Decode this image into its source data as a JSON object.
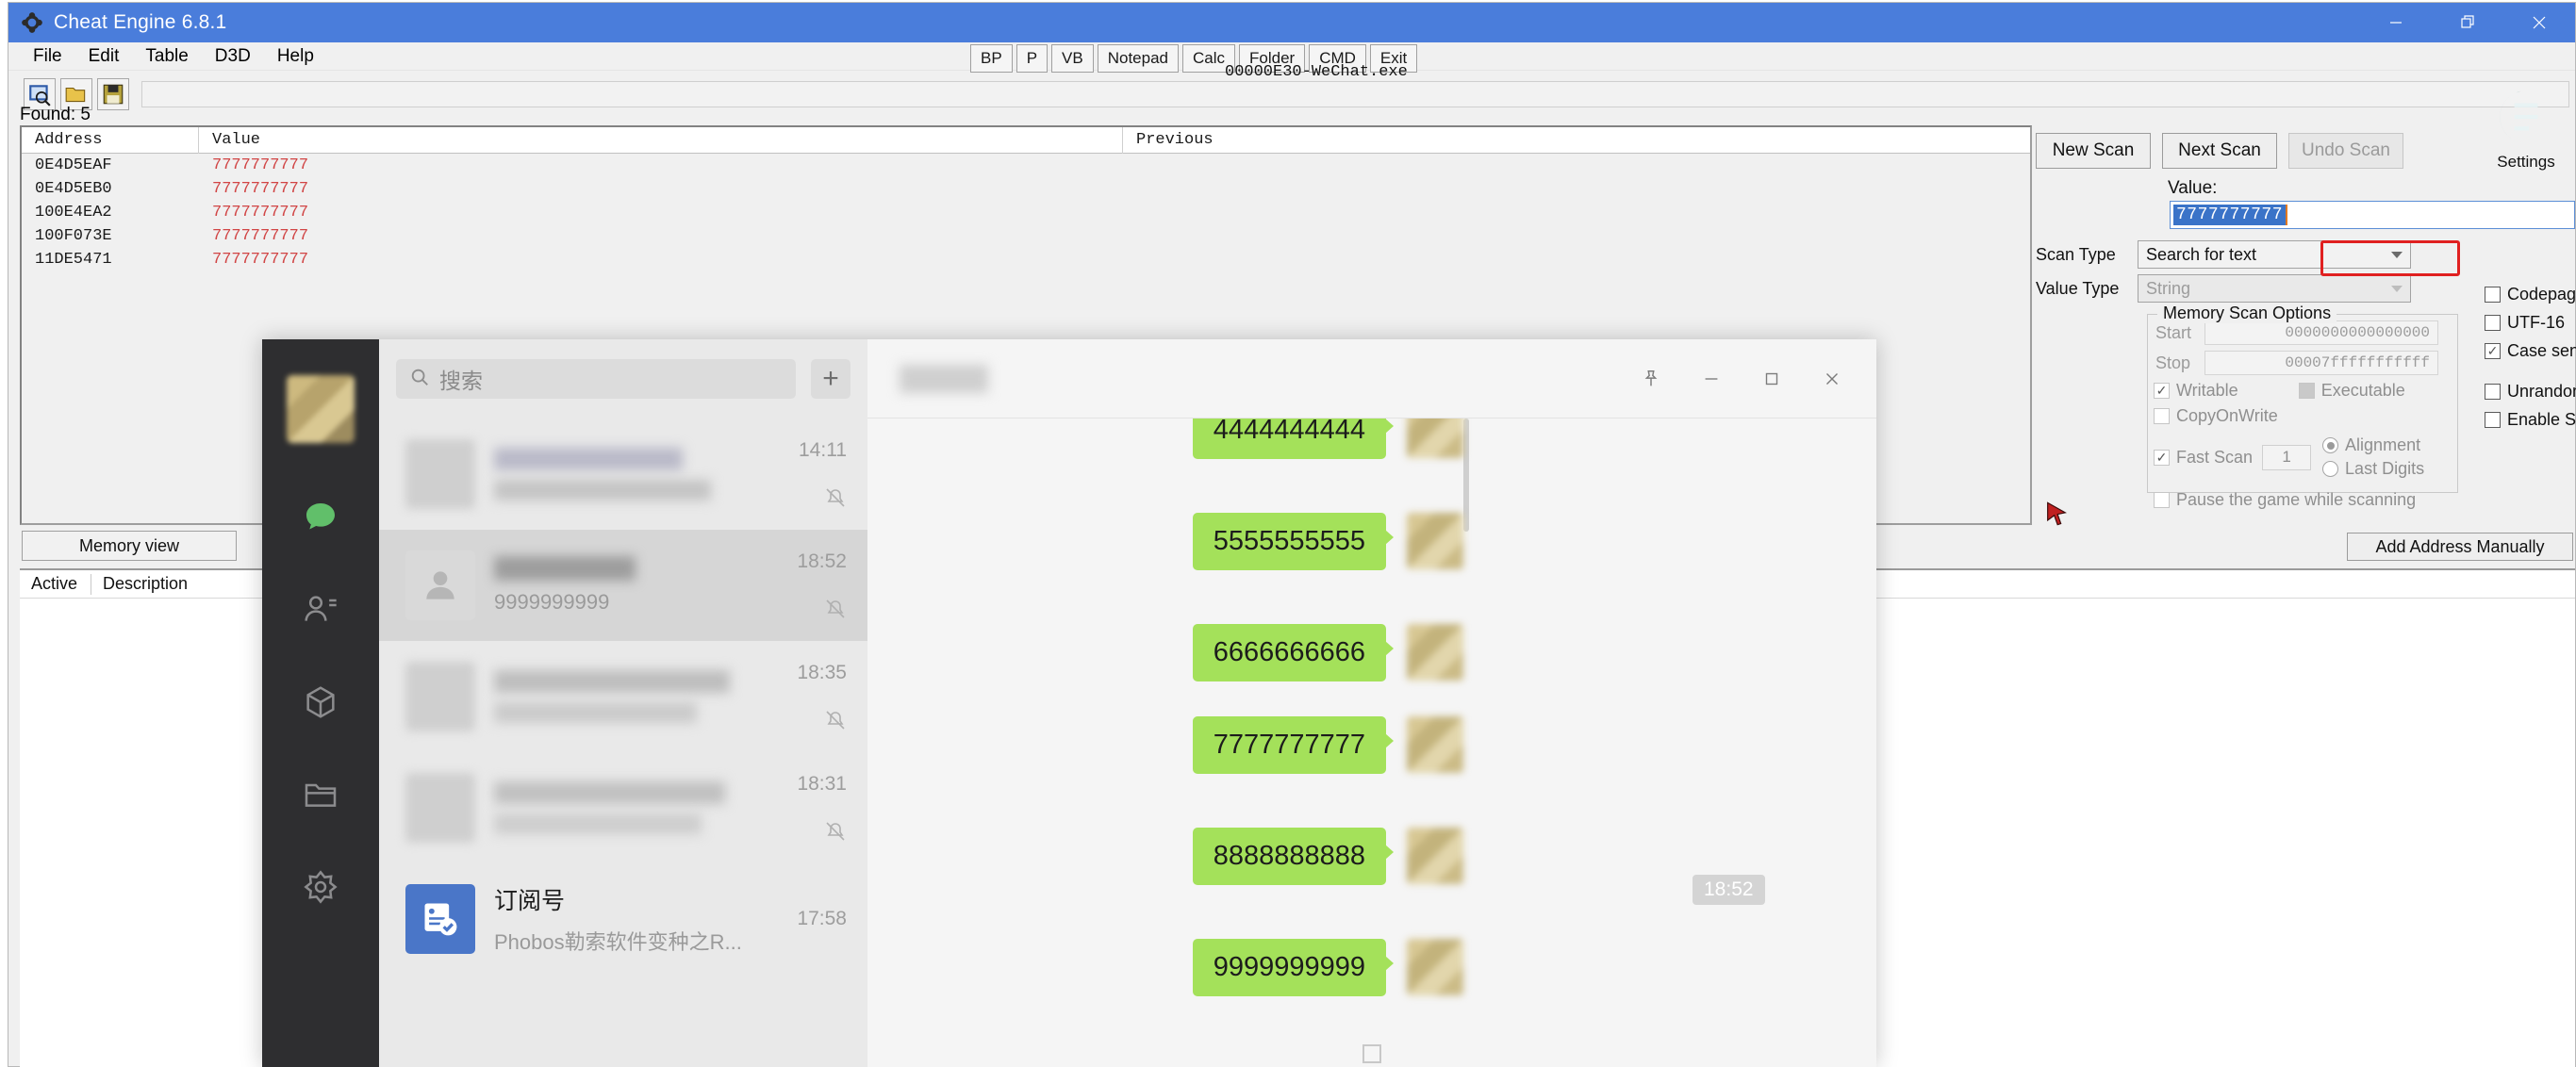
{
  "cheat_engine": {
    "window_title": "Cheat Engine 6.8.1",
    "window_controls": {
      "minimize": "minimize-icon",
      "restore": "restore-icon",
      "close": "close-icon"
    },
    "menu": [
      "File",
      "Edit",
      "Table",
      "D3D",
      "Help"
    ],
    "quick_toolbar": [
      "BP",
      "P",
      "VB",
      "Notepad",
      "Calc",
      "Folder",
      "CMD",
      "Exit"
    ],
    "process_name": "00000E30-WeChat.exe",
    "found_label": "Found: 5",
    "table": {
      "headers": [
        "Address",
        "Value",
        "Previous"
      ],
      "rows": [
        {
          "address": "0E4D5EAF",
          "value": "7777777777",
          "previous": ""
        },
        {
          "address": "0E4D5EB0",
          "value": "7777777777",
          "previous": ""
        },
        {
          "address": "100E4EA2",
          "value": "7777777777",
          "previous": ""
        },
        {
          "address": "100F073E",
          "value": "7777777777",
          "previous": ""
        },
        {
          "address": "11DE5471",
          "value": "7777777777",
          "previous": ""
        }
      ]
    },
    "memory_view_button": "Memory view",
    "bottom_list_headers": [
      "Active",
      "Description"
    ],
    "scan": {
      "new_scan": "New Scan",
      "next_scan": "Next Scan",
      "undo_scan": "Undo Scan",
      "settings_label": "Settings",
      "value_label": "Value:",
      "value_text": "7777777777",
      "scan_type_label": "Scan Type",
      "scan_type_value": "Search for text",
      "value_type_label": "Value Type",
      "value_type_value": "String",
      "memory_scan_options_title": "Memory Scan Options",
      "start_label": "Start",
      "start_value": "0000000000000000",
      "stop_label": "Stop",
      "stop_value": "00007fffffffffff",
      "writable": "Writable",
      "executable": "Executable",
      "copy_on_write": "CopyOnWrite",
      "fast_scan": "Fast Scan",
      "fast_scan_value": "1",
      "alignment": "Alignment",
      "last_digits": "Last Digits",
      "pause_game": "Pause the game while scanning",
      "codepage": "Codepage",
      "utf16": "UTF-16",
      "case_sensitive": "Case sensitive",
      "unrandomizer": "Unrandomizer",
      "enable_speedhack": "Enable Speedhack",
      "add_address_manually": "Add Address Manually",
      "highlight_color": "#e02020"
    }
  },
  "wechat": {
    "rail_icons": [
      "chat-icon",
      "contacts-icon",
      "miniprogram-icon",
      "files-icon",
      "settings-icon"
    ],
    "search_placeholder": "搜索",
    "add_button": "+",
    "chats": [
      {
        "name": "",
        "preview": "",
        "time": "14:11",
        "blurred": true,
        "muted": true,
        "selected": false
      },
      {
        "name": "",
        "preview": "9999999999",
        "time": "18:52",
        "blurred": true,
        "muted": true,
        "selected": true
      },
      {
        "name": "",
        "preview": "",
        "time": "18:35",
        "blurred": true,
        "muted": true,
        "selected": false
      },
      {
        "name": "",
        "preview": "",
        "time": "18:31",
        "blurred": true,
        "muted": true,
        "selected": false
      },
      {
        "name": "订阅号",
        "preview": "Phobos勒索软件变种之R...",
        "time": "17:58",
        "blurred": false,
        "muted": false,
        "selected": false
      }
    ],
    "title_controls": [
      "pin-icon",
      "minimize-icon",
      "maximize-icon",
      "close-icon"
    ],
    "conversation": {
      "timestamp_chip": "18:52",
      "messages": [
        {
          "text": "4444444444",
          "outgoing": true
        },
        {
          "text": "5555555555",
          "outgoing": true
        },
        {
          "text": "6666666666",
          "outgoing": true
        },
        {
          "text": "7777777777",
          "outgoing": true
        },
        {
          "text": "8888888888",
          "outgoing": true
        },
        {
          "text": "9999999999",
          "outgoing": true
        }
      ],
      "bubble_color": "#a4e15a"
    }
  }
}
